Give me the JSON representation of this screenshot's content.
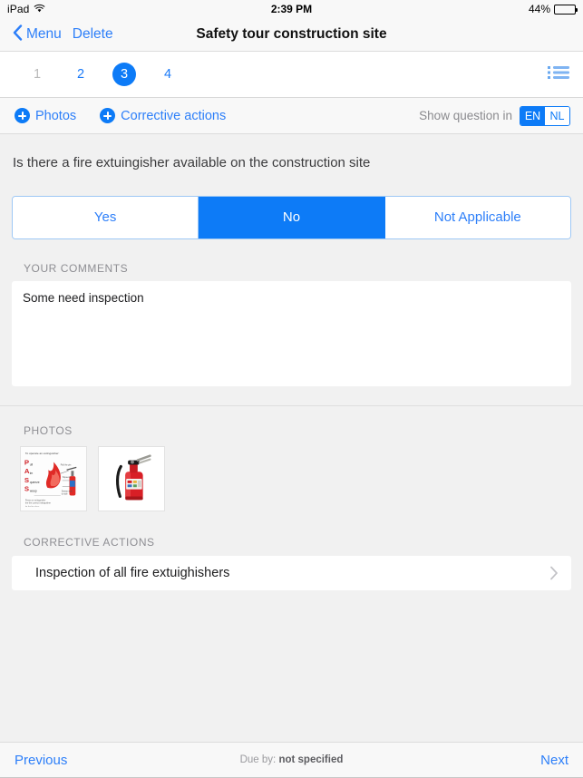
{
  "status_bar": {
    "device": "iPad",
    "wifi_icon": "wifi-icon",
    "time": "2:39 PM",
    "battery_percent": "44%",
    "battery_level": 44
  },
  "nav_bar": {
    "back_icon": "chevron-left-icon",
    "back_label": "Menu",
    "delete_label": "Delete",
    "title": "Safety tour construction site"
  },
  "pager": {
    "pages": [
      {
        "label": "1",
        "state": "muted"
      },
      {
        "label": "2",
        "state": "default"
      },
      {
        "label": "3",
        "state": "active"
      },
      {
        "label": "4",
        "state": "default"
      }
    ],
    "list_icon": "list-bullet-icon"
  },
  "action_bar": {
    "photos_label": "Photos",
    "photos_icon": "plus-circle-icon",
    "corrective_label": "Corrective actions",
    "corrective_icon": "plus-circle-icon",
    "language_prompt": "Show question in",
    "languages": [
      {
        "code": "EN",
        "selected": true
      },
      {
        "code": "NL",
        "selected": false
      }
    ]
  },
  "question": {
    "text": "Is there a fire extuingisher available on the construction site",
    "answers": [
      {
        "label": "Yes",
        "selected": false
      },
      {
        "label": "No",
        "selected": true
      },
      {
        "label": "Not Applicable",
        "selected": false
      }
    ]
  },
  "comments": {
    "section_label": "YOUR COMMENTS",
    "value": "Some need inspection",
    "placeholder": ""
  },
  "photos": {
    "section_label": "PHOTOS",
    "items": [
      {
        "name": "fire-extinguisher-pass-diagram-photo"
      },
      {
        "name": "fire-extinguisher-photo"
      }
    ]
  },
  "corrective_actions": {
    "section_label": "CORRECTIVE ACTIONS",
    "items": [
      {
        "title": "Inspection of all fire extuighishers",
        "chevron_icon": "chevron-right-icon"
      }
    ]
  },
  "toolbar": {
    "previous_label": "Previous",
    "next_label": "Next",
    "due_label": "Due by:",
    "due_value": "not specified"
  },
  "colors": {
    "accent": "#0d7bf7",
    "link": "#2d7ff9",
    "page_background": "#f1f1f1",
    "card": "#ffffff",
    "muted_text": "#8e8e93"
  }
}
